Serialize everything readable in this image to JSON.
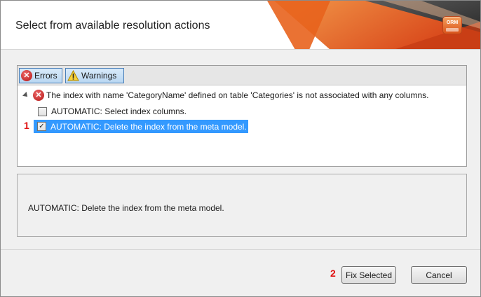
{
  "dialog": {
    "title": "Select from available resolution actions",
    "logo_text": "ORM"
  },
  "toolbar": {
    "errors_label": "Errors",
    "warnings_label": "Warnings"
  },
  "tree": {
    "error_message": "The index with name 'CategoryName' defined on table 'Categories' is not associated with any columns.",
    "actions": [
      {
        "label": "AUTOMATIC: Select index columns.",
        "checked": false,
        "selected": false
      },
      {
        "label": "AUTOMATIC: Delete the index from the meta model.",
        "checked": true,
        "selected": true
      }
    ]
  },
  "markers": {
    "selected_action": "1",
    "fix_button": "2"
  },
  "description": {
    "text": "AUTOMATIC: Delete the index from the meta model."
  },
  "buttons": {
    "fix_selected": "Fix Selected",
    "cancel": "Cancel"
  },
  "colors": {
    "selection": "#3399ff",
    "accent_orange": "#e8631d",
    "marker_red": "#e01010"
  }
}
